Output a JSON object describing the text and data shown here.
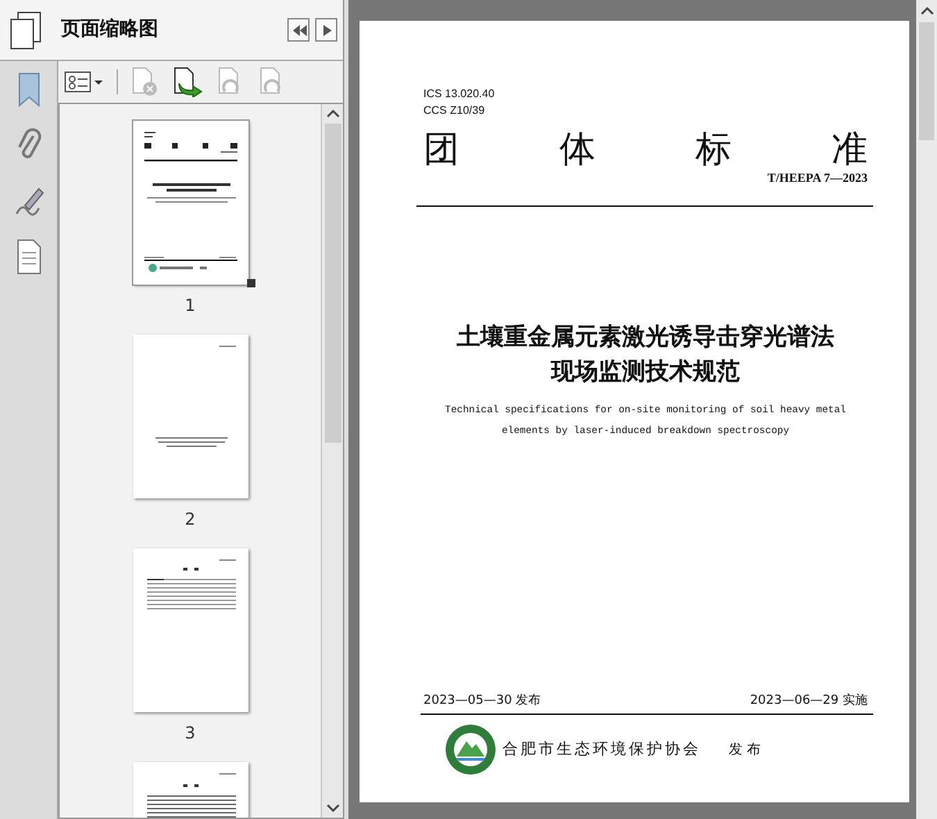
{
  "sidebar_tools": [
    {
      "kind": "bookmarks"
    },
    {
      "kind": "attachments"
    },
    {
      "kind": "signatures"
    },
    {
      "kind": "pages"
    }
  ],
  "panel": {
    "title": "页面缩略图",
    "nav": [
      {
        "kind": "collapse"
      },
      {
        "kind": "expand"
      }
    ]
  },
  "toolbar": [
    {
      "kind": "options",
      "disabled": false
    },
    {
      "kind": "delete",
      "disabled": true
    },
    {
      "kind": "insert",
      "disabled": false
    },
    {
      "kind": "undo",
      "disabled": true
    },
    {
      "kind": "redo",
      "disabled": true
    }
  ],
  "thumbnails": [
    {
      "kind": "cover",
      "label": "1",
      "selected": true
    },
    {
      "kind": "title",
      "label": "2",
      "selected": false
    },
    {
      "kind": "contents",
      "label": "3",
      "selected": false
    },
    {
      "kind": "text",
      "selected": false
    }
  ],
  "document": {
    "codes": [
      "ICS 13.020.40",
      "CCS Z10/39"
    ],
    "heading": [
      "团",
      "体",
      "标",
      "准"
    ],
    "number": "T/HEEPA 7—2023",
    "title_lines": [
      "土壤重金属元素激光诱导击穿光谱法",
      "现场监测技术规范"
    ],
    "english_lines": [
      "Technical specifications for on-site monitoring of soil heavy metal",
      "elements by laser-induced breakdown spectroscopy"
    ],
    "issue_date": "2023—05—30 发布",
    "effective_date": "2023—06—29 实施",
    "publisher": "合肥市生态环境保护协会",
    "publish_word": "发 布"
  }
}
